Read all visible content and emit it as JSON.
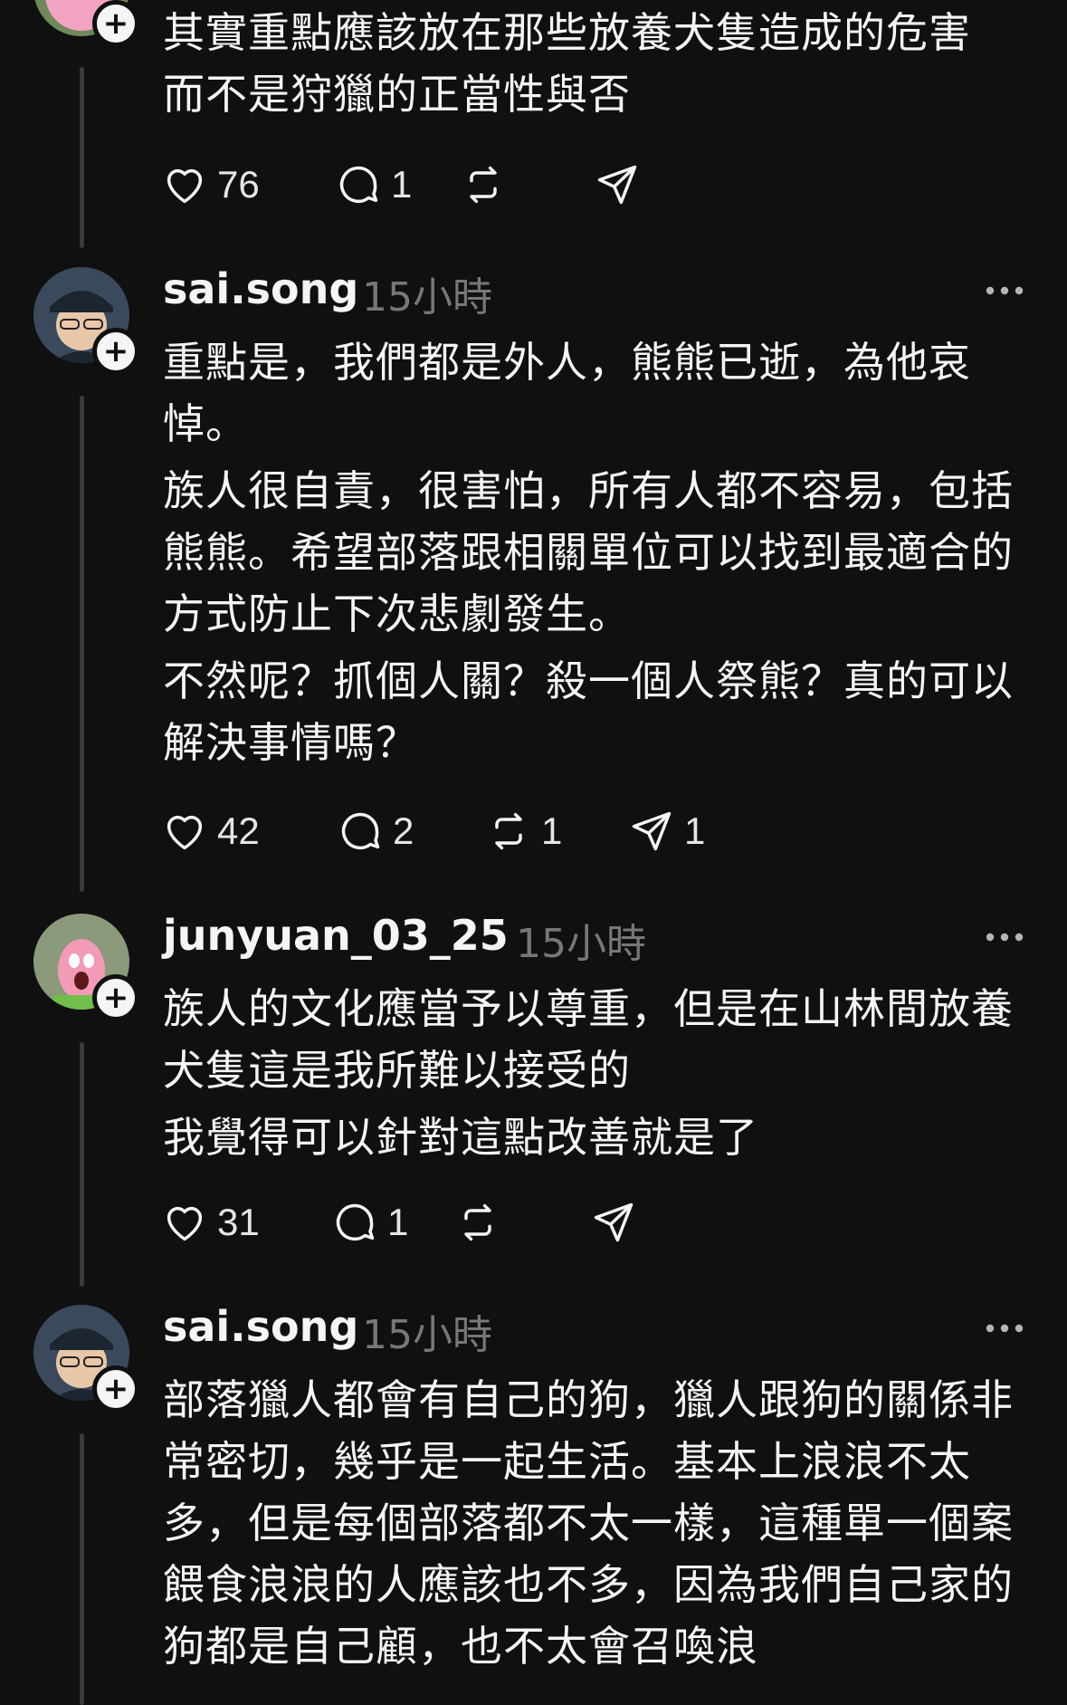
{
  "posts": [
    {
      "username": "",
      "time": "",
      "lines": [
        "其實重點應該放在那些放養犬隻造成的危害\n而不是狩獵的正當性與否"
      ],
      "likes": "76",
      "replies": "1",
      "reposts": "",
      "shares": ""
    },
    {
      "username": "sai.song",
      "time": "15小時",
      "lines": [
        "重點是，我們都是外人，熊熊已逝，為他哀悼。",
        "族人很自責，很害怕，所有人都不容易，包括熊熊。希望部落跟相關單位可以找到最適合的方式防止下次悲劇發生。",
        "不然呢？抓個人關？殺一個人祭熊？真的可以解決事情嗎？"
      ],
      "likes": "42",
      "replies": "2",
      "reposts": "1",
      "shares": "1"
    },
    {
      "username": "junyuan_03_25",
      "time": "15小時",
      "lines": [
        "族人的文化應當予以尊重，但是在山林間放養犬隻這是我所難以接受的",
        "我覺得可以針對這點改善就是了"
      ],
      "likes": "31",
      "replies": "1",
      "reposts": "",
      "shares": ""
    },
    {
      "username": "sai.song",
      "time": "15小時",
      "lines": [
        "部落獵人都會有自己的狗，獵人跟狗的關係非常密切，幾乎是一起生活。基本上浪浪不太多，但是每個部落都不太一樣，這種單一個案餵食浪浪的人應該也不多，因為我們自己家的狗都是自己顧，也不太會召喚浪"
      ],
      "likes": "",
      "replies": "",
      "reposts": "",
      "shares": ""
    }
  ],
  "icons": {
    "like": "heart-icon",
    "reply": "comment-icon",
    "repost": "repost-icon",
    "share": "share-icon",
    "more": "more-icon",
    "follow": "follow-plus-icon"
  },
  "colors": {
    "background": "#101010",
    "text": "#f3f5f7",
    "muted": "#777777",
    "thread_line": "#3a3a3a"
  }
}
